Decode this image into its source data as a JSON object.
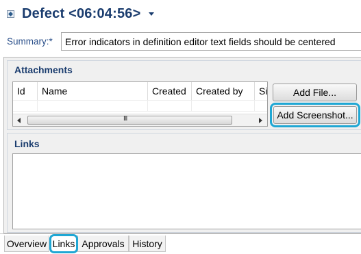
{
  "header": {
    "icon": "defect-icon",
    "title": "Defect <06:04:56>",
    "menu_icon": "chevron-down-icon"
  },
  "summary": {
    "label": "Summary:*",
    "value": "Error indicators in definition editor text fields should be centered"
  },
  "attachments": {
    "title": "Attachments",
    "columns": [
      "Id",
      "Name",
      "Created",
      "Created by",
      "Siz"
    ],
    "rows": [],
    "scrollbar_grip": "III",
    "buttons": {
      "add_file": "Add File...",
      "add_screenshot": "Add Screenshot..."
    }
  },
  "links": {
    "title": "Links"
  },
  "tabs": [
    {
      "label": "Overview",
      "selected": false
    },
    {
      "label": "Links",
      "selected": true
    },
    {
      "label": "Approvals",
      "selected": false
    },
    {
      "label": "History",
      "selected": false
    }
  ],
  "colors": {
    "title_blue": "#1a3c6e",
    "label_blue": "#2a4f8a",
    "highlight": "#1fa7d4"
  }
}
